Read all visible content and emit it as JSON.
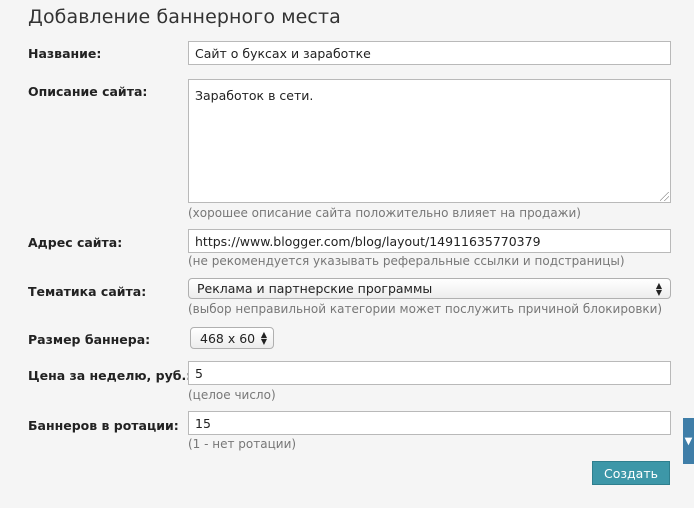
{
  "title": "Добавление баннерного места",
  "form": {
    "name": {
      "label": "Название:",
      "value": "Сайт о буксах и заработке"
    },
    "description": {
      "label": "Описание сайта:",
      "value": "Заработок в сети.",
      "hint": "(хорошее описание сайта положительно влияет на продажи)"
    },
    "url": {
      "label": "Адрес сайта:",
      "value": "https://www.blogger.com/blog/layout/14911635770379",
      "hint": "(не рекомендуется указывать реферальные ссылки и подстраницы)"
    },
    "topic": {
      "label": "Тематика сайта:",
      "selected": "Реклама и партнерские программы",
      "hint": "(выбор неправильной категории может послужить причиной блокировки)"
    },
    "size": {
      "label": "Размер баннера:",
      "selected": "468 x 60"
    },
    "price": {
      "label": "Цена за неделю, руб.:",
      "value": "5",
      "hint": "(целое число)"
    },
    "rotation": {
      "label": "Баннеров в ротации:",
      "value": "15",
      "hint": "(1 - нет ротации)"
    }
  },
  "submit_label": "Создать",
  "colors": {
    "accent": "#3d97a8",
    "side_tab": "#3f7ea8"
  },
  "icons": {
    "select_arrows": "updown-arrows-icon",
    "side_tab": "chevron-down-icon"
  }
}
